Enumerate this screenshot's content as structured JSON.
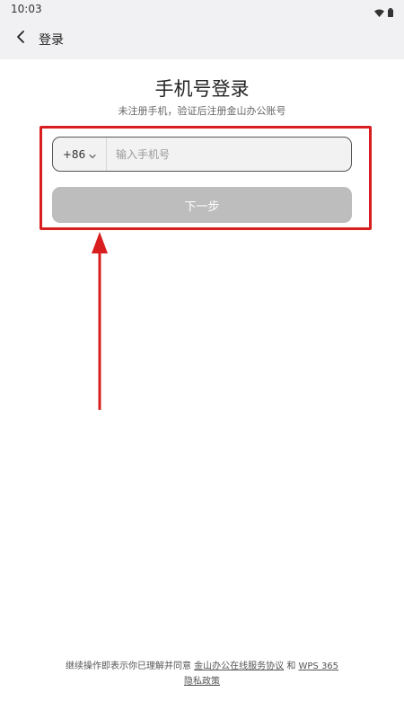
{
  "status_bar": {
    "time": "10:03",
    "icons": [
      "wifi-icon",
      "battery-icon"
    ]
  },
  "header": {
    "back_icon": "chevron-left-icon",
    "title": "登录"
  },
  "main": {
    "title": "手机号登录",
    "subtitle": "未注册手机，验证后注册金山办公账号",
    "phone": {
      "country_code": "+86",
      "country_code_icon": "chevron-down-icon",
      "placeholder": "输入手机号",
      "value": ""
    },
    "next_button": "下一步"
  },
  "annotation": {
    "box_color": "#d81e1e",
    "arrow_color": "#d81e1e"
  },
  "footer": {
    "prefix": "继续操作即表示你已理解并同意 ",
    "link1": "金山办公在线服务协议",
    "conjunction": " 和 ",
    "link2": "WPS 365隐私政策"
  },
  "colors": {
    "header_bg": "#f1f1f3",
    "button_disabled": "#bdbdbd",
    "input_bg": "#f2f2f2"
  }
}
